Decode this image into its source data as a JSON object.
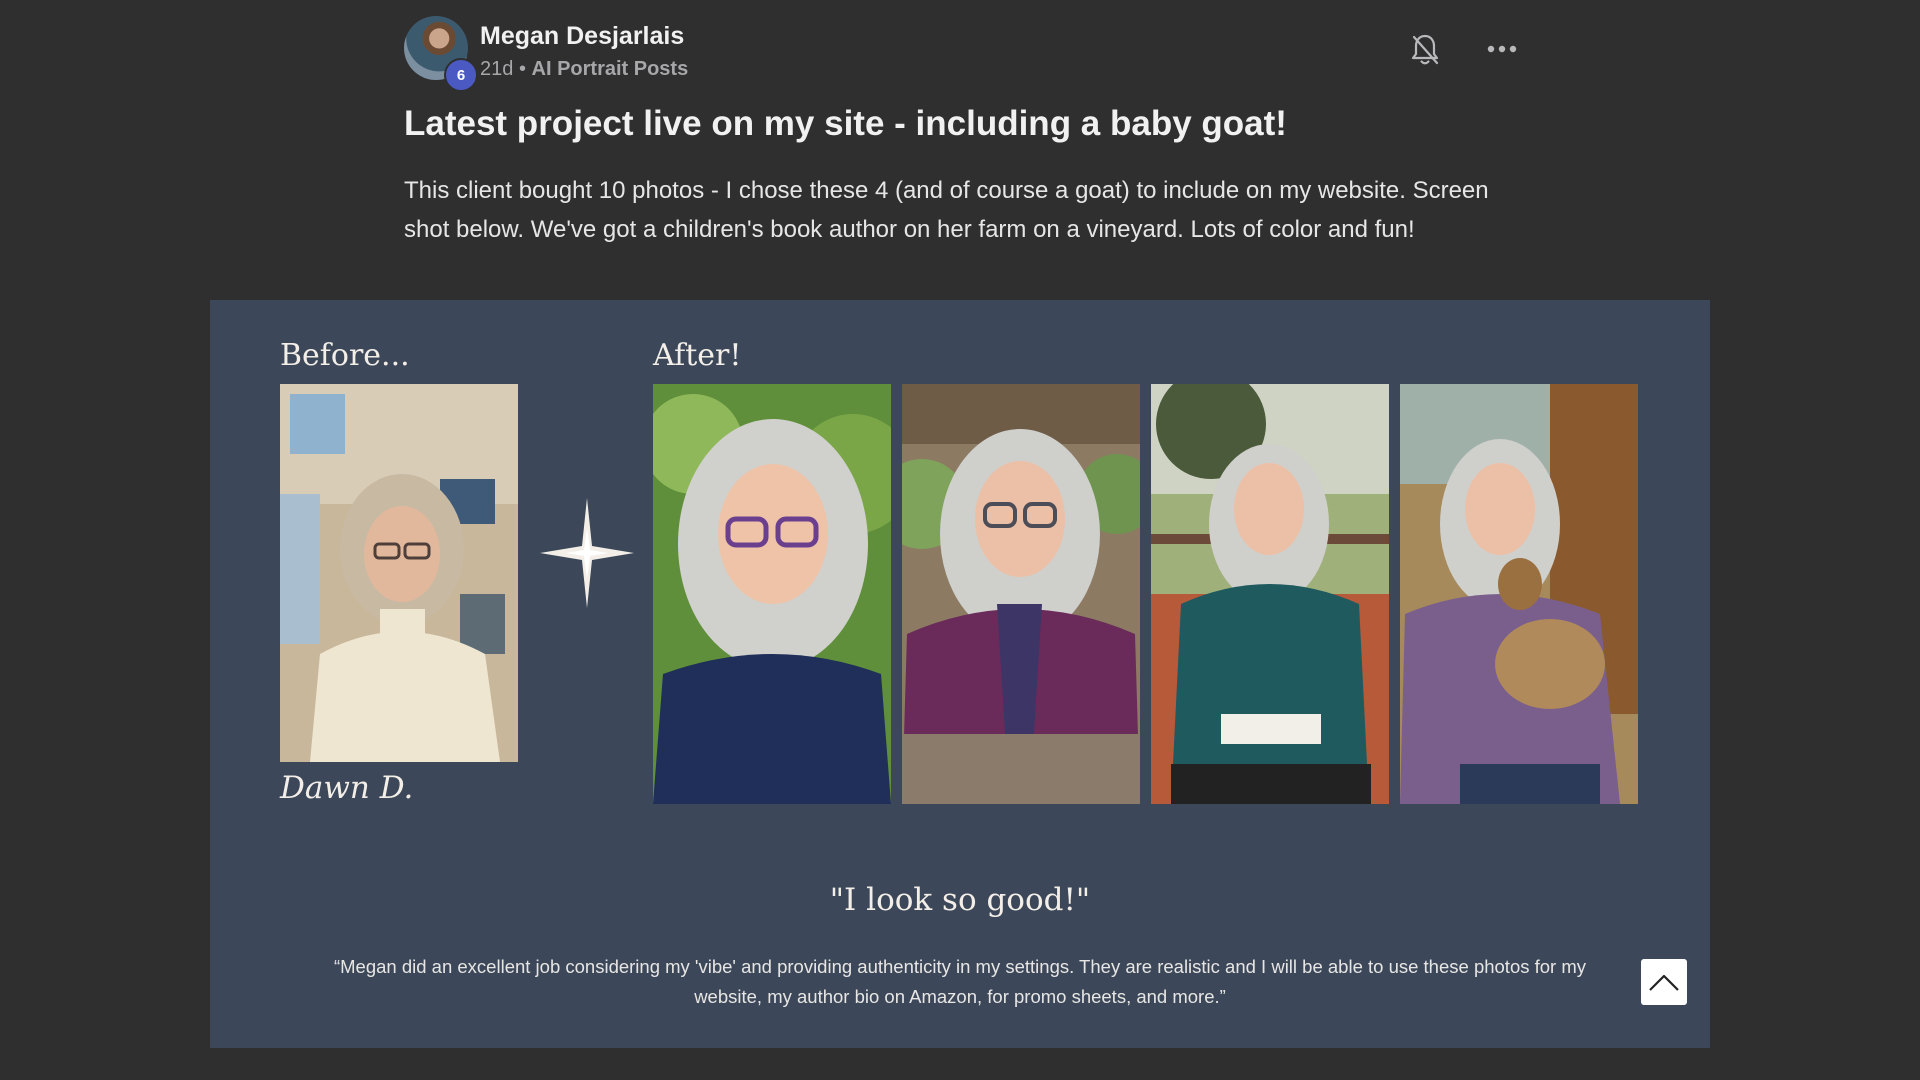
{
  "post": {
    "author": "Megan Desjarlais",
    "level": "6",
    "age": "21d",
    "separator": "•",
    "category": "AI Portrait Posts",
    "title": "Latest project live on my site - including a baby goat!",
    "body": "This client bought 10 photos - I chose these 4 (and of course a goat) to include on my website. Screen shot below. We've got a children's book author on her farm on a vineyard. Lots of color and fun!"
  },
  "icons": {
    "notification": "bell-off-icon",
    "more": "more-horizontal-icon",
    "scroll_top": "chevron-up-icon",
    "sparkle": "four-point-star-icon"
  },
  "image": {
    "before_label": "Before...",
    "after_label": "After!",
    "client_name": "Dawn D.",
    "quote_title": "\"I look so good!\"",
    "testimonial": "“Megan did an excellent job considering my 'vibe' and providing authenticity in my settings. They are realistic and I will be able to use these photos for my website, my author bio on Amazon, for promo sheets, and more.”"
  },
  "colors": {
    "page_bg": "#2f2f30",
    "panel_bg": "#3c4859",
    "badge": "#4b5ac2"
  }
}
